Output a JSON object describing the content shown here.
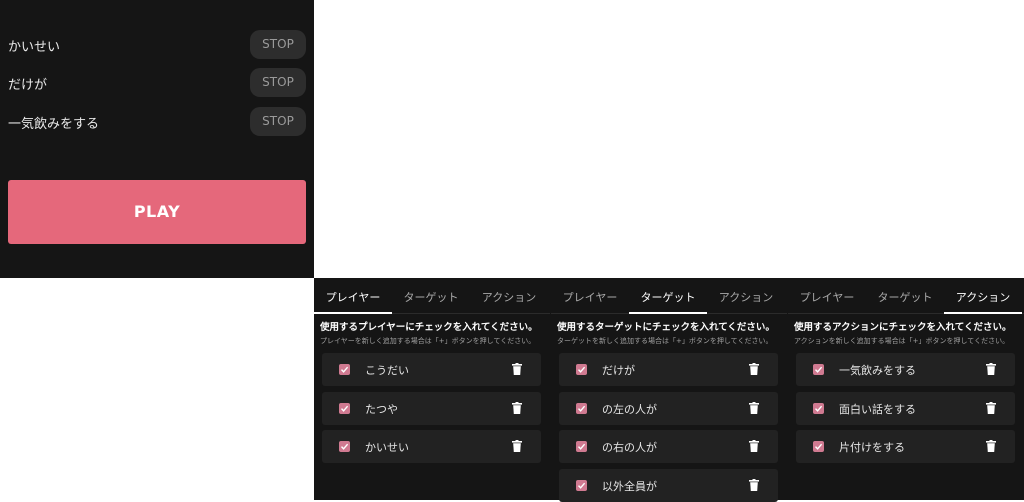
{
  "game": {
    "slots": [
      {
        "label": "かいせい",
        "button": "STOP"
      },
      {
        "label": "だけが",
        "button": "STOP"
      },
      {
        "label": "一気飲みをする",
        "button": "STOP"
      }
    ],
    "play_label": "PLAY"
  },
  "colors": {
    "accent": "#e5687b",
    "checkbox": "#d07a91",
    "background": "#151515"
  },
  "panels": [
    {
      "tabs": [
        "プレイヤー",
        "ターゲット",
        "アクション"
      ],
      "active_tab": 0,
      "heading": "使用するプレイヤーにチェックを入れてください。",
      "subtext": "プレイヤーを新しく追加する場合は「+」ボタンを押してください。",
      "items": [
        {
          "label": "こうだい",
          "checked": true
        },
        {
          "label": "たつや",
          "checked": true
        },
        {
          "label": "かいせい",
          "checked": true
        }
      ]
    },
    {
      "tabs": [
        "プレイヤー",
        "ターゲット",
        "アクション"
      ],
      "active_tab": 1,
      "heading": "使用するターゲットにチェックを入れてください。",
      "subtext": "ターゲットを新しく追加する場合は「+」ボタンを押してください。",
      "items": [
        {
          "label": "だけが",
          "checked": true
        },
        {
          "label": "の左の人が",
          "checked": true
        },
        {
          "label": "の右の人が",
          "checked": true
        },
        {
          "label": "以外全員が",
          "checked": true
        }
      ]
    },
    {
      "tabs": [
        "プレイヤー",
        "ターゲット",
        "アクション"
      ],
      "active_tab": 2,
      "heading": "使用するアクションにチェックを入れてください。",
      "subtext": "アクションを新しく追加する場合は「+」ボタンを押してください。",
      "items": [
        {
          "label": "一気飲みをする",
          "checked": true
        },
        {
          "label": "面白い話をする",
          "checked": true
        },
        {
          "label": "片付けをする",
          "checked": true
        }
      ]
    }
  ]
}
